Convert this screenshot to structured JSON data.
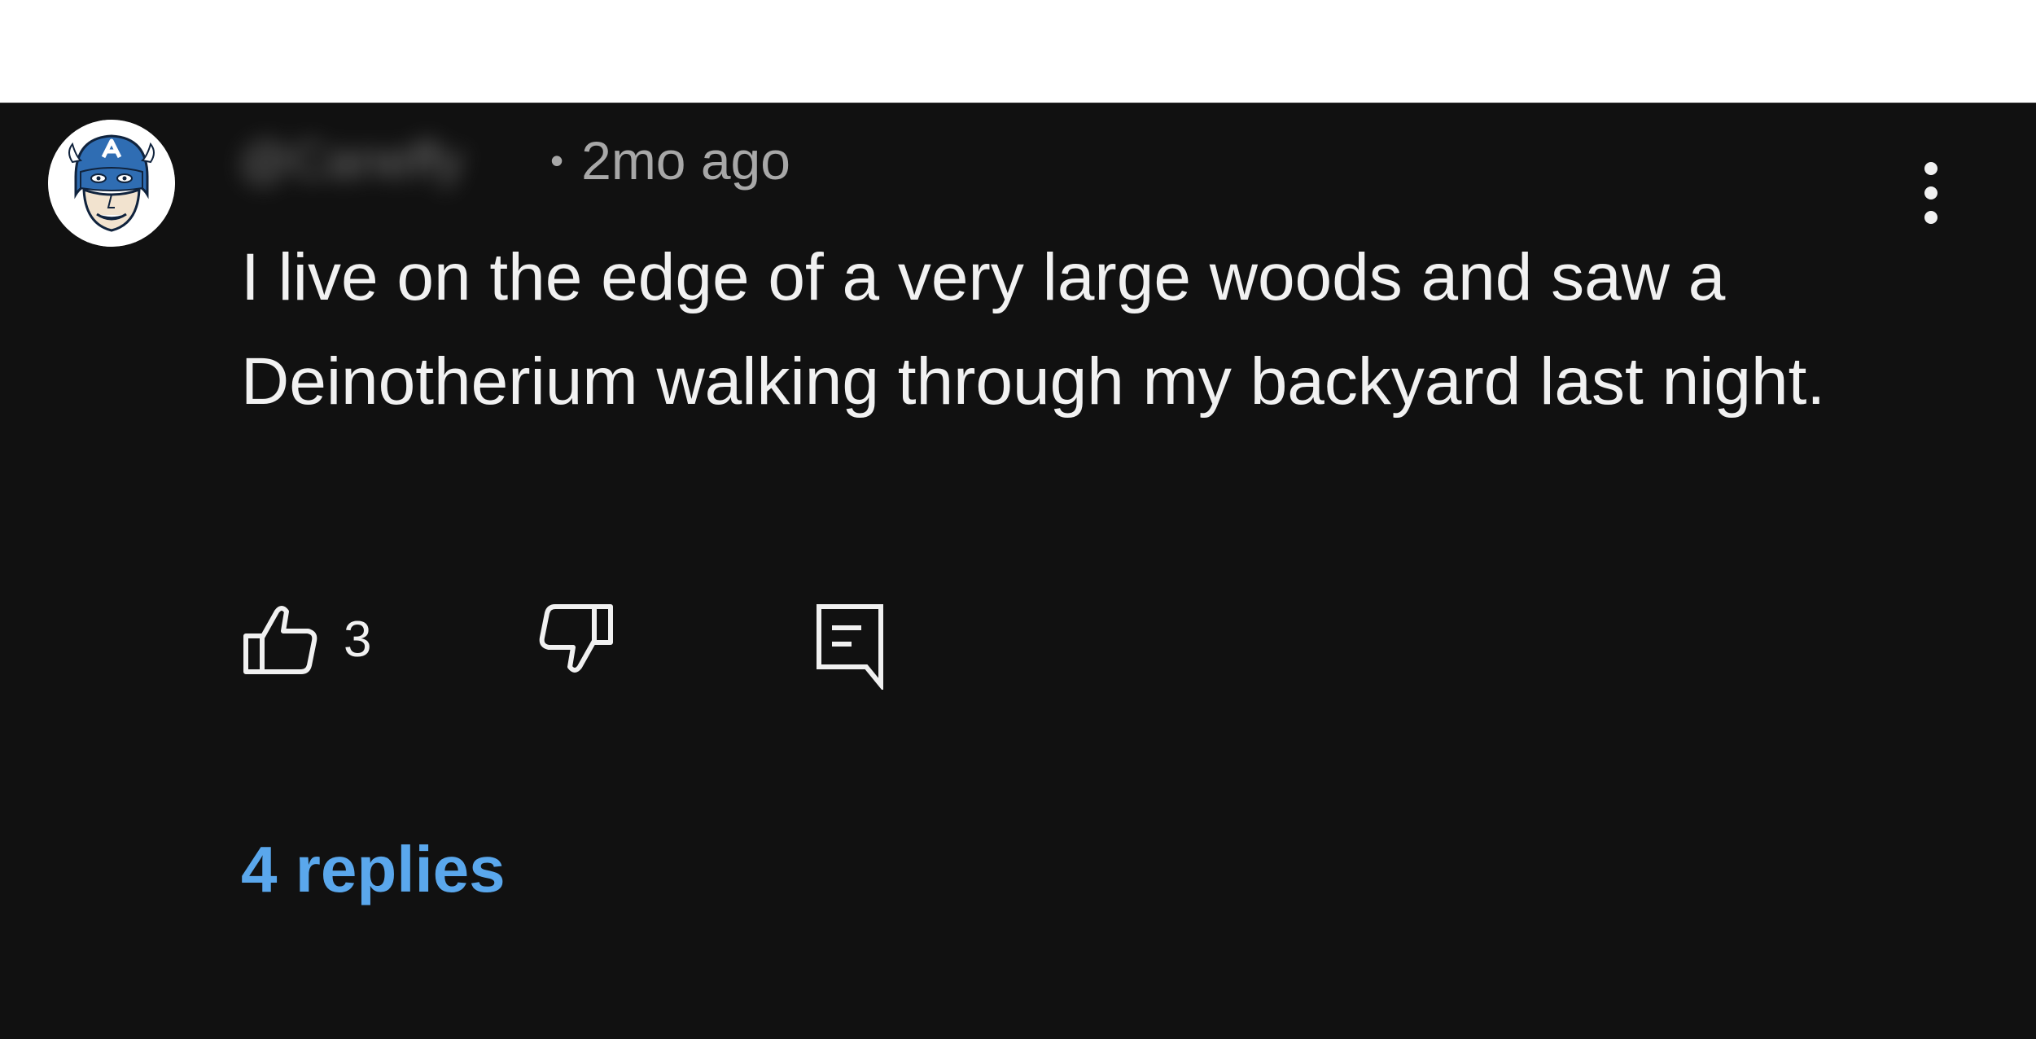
{
  "comment": {
    "author": "@Caneffy",
    "separator": "•",
    "timestamp": "2mo ago",
    "text": "I live on the edge of a very large woods and saw a Deinotherium walking through my backyard last night.",
    "like_count": "3",
    "replies_label": "4 replies"
  },
  "icons": {
    "avatar": "captain-america-avatar",
    "more": "more-vertical-icon",
    "like": "thumbs-up-icon",
    "dislike": "thumbs-down-icon",
    "reply": "reply-comment-icon"
  },
  "colors": {
    "background": "#111111",
    "text": "#f1f1f1",
    "meta": "#a8a8a8",
    "link": "#5aa7ec"
  }
}
